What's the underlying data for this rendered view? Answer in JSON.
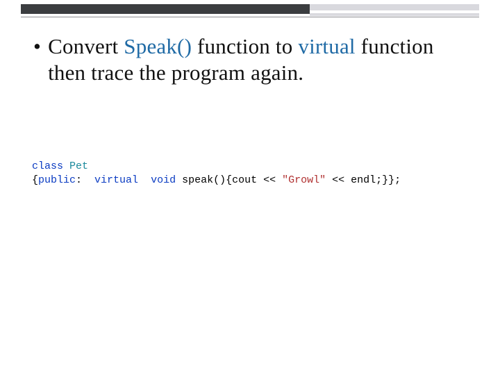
{
  "bullet": {
    "dot": "•",
    "parts": {
      "p1": "Convert ",
      "speak": "Speak()",
      "p2": " function to ",
      "virtual": "virtual",
      "p3": " function then trace the program again."
    }
  },
  "code": {
    "l1": {
      "kw_class": "class",
      "sp1": " ",
      "type_pet": "Pet"
    },
    "l2": {
      "brace_open": "{",
      "kw_public": "public",
      "colon_sp": ":  ",
      "kw_virtual": "virtual",
      "sp1": "  ",
      "kw_void": "void",
      "sp2": " ",
      "fn": "speak(){cout << ",
      "str": "\"Growl\"",
      "rest": " << endl;}};"
    }
  }
}
